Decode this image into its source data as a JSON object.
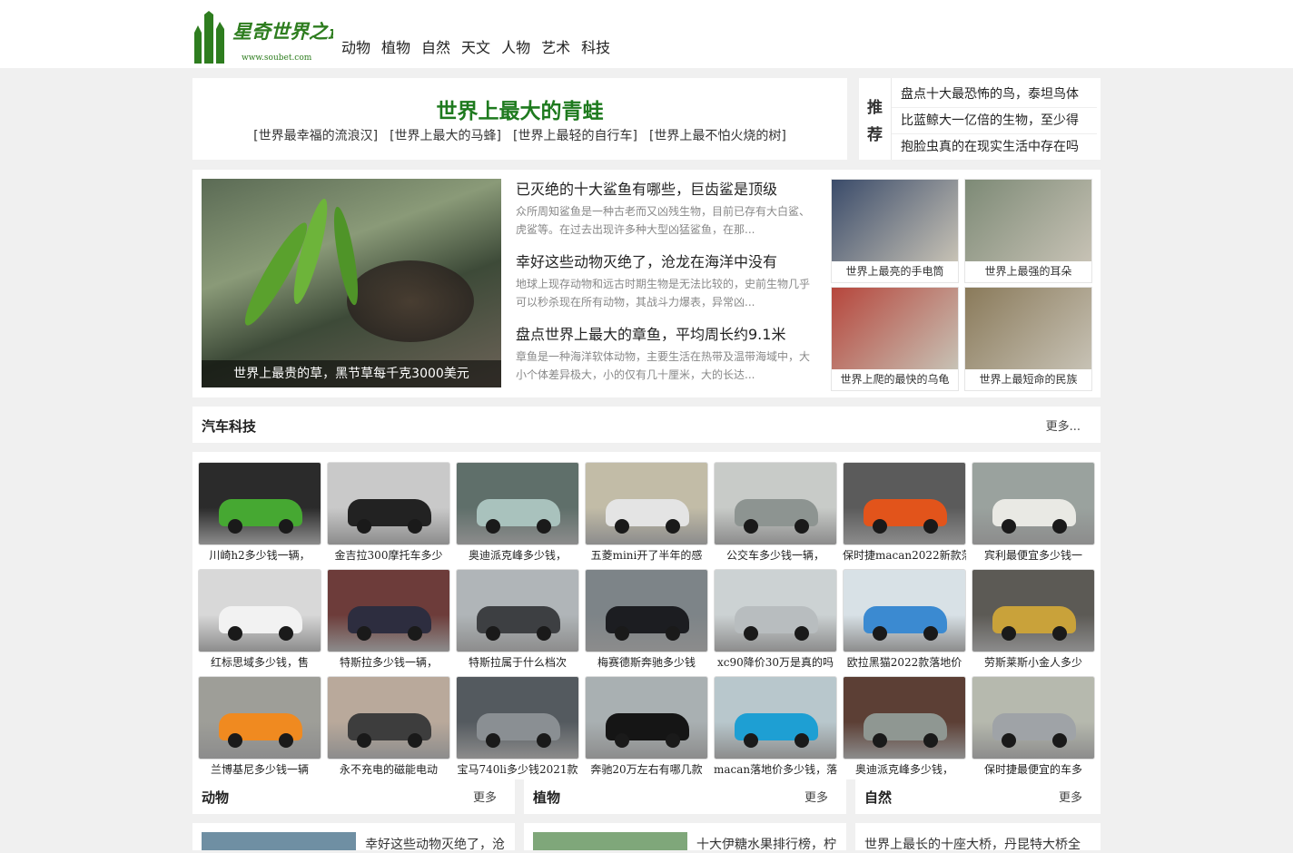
{
  "logo": {
    "text": "星奇世界之最",
    "url_text": "www.soubet.com",
    "color": "#2e7d1f"
  },
  "nav": [
    "动物",
    "植物",
    "自然",
    "天文",
    "人物",
    "艺术",
    "科技"
  ],
  "headline": {
    "title": "世界上最大的青蛙",
    "links": [
      "[世界最幸福的流浪汉]",
      "[世界上最大的马蜂]",
      "[世界上最轻的自行车]",
      "[世界上最不怕火烧的树]"
    ]
  },
  "recommend": {
    "label_1": "推",
    "label_2": "荐",
    "items": [
      "盘点十大最恐怖的鸟，泰坦鸟体",
      "比蓝鲸大一亿倍的生物，至少得",
      "抱脸虫真的在现实生活中存在吗"
    ]
  },
  "feature": {
    "caption": "世界上最贵的草，黑节草每千克3000美元",
    "articles": [
      {
        "title": "已灭绝的十大鲨鱼有哪些，巨齿鲨是顶级",
        "desc": "众所周知鲨鱼是一种古老而又凶残生物，目前已存有大白鲨、虎鲨等。在过去出现许多种大型凶猛鲨鱼，在那..."
      },
      {
        "title": "幸好这些动物灭绝了，沧龙在海洋中没有",
        "desc": "地球上现存动物和远古时期生物是无法比较的，史前生物几乎可以秒杀现在所有动物，其战斗力爆表，异常凶..."
      },
      {
        "title": "盘点世界上最大的章鱼，平均周长约9.1米",
        "desc": "章鱼是一种海洋软体动物，主要生活在热带及温带海域中，大小个体差异极大，小的仅有几十厘米，大的长达..."
      }
    ],
    "thumbs": [
      {
        "caption": "世界上最亮的手电筒",
        "color": "#3a4b6a"
      },
      {
        "caption": "世界上最强的耳朵",
        "color": "#7d8a76"
      },
      {
        "caption": "世界上爬的最快的乌龟",
        "color": "#b6463c"
      },
      {
        "caption": "世界上最短命的民族",
        "color": "#8a7a5a"
      }
    ]
  },
  "car_section": {
    "title": "汽车科技",
    "more": "更多...",
    "items": [
      {
        "caption": "川崎h2多少钱一辆，",
        "color": "#2b2b2b",
        "accent": "#46a832"
      },
      {
        "caption": "金吉拉300摩托车多少",
        "color": "#c9c9c9",
        "accent": "#222222"
      },
      {
        "caption": "奥迪派克峰多少钱，",
        "color": "#5f6f6a",
        "accent": "#a9c2bd"
      },
      {
        "caption": "五菱mini开了半年的感",
        "color": "#c2bca7",
        "accent": "#e4e4e4"
      },
      {
        "caption": "公交车多少钱一辆，",
        "color": "#c8cbc8",
        "accent": "#8d9491"
      },
      {
        "caption": "保时捷macan2022新款落",
        "color": "#5b5b5b",
        "accent": "#e2541b"
      },
      {
        "caption": "宾利最便宜多少钱一",
        "color": "#9aa29e",
        "accent": "#e9e9e4"
      },
      {
        "caption": "红标思域多少钱，售",
        "color": "#d8d8d8",
        "accent": "#f2f2f2"
      },
      {
        "caption": "特斯拉多少钱一辆，",
        "color": "#6d3c3a",
        "accent": "#2d2d3f"
      },
      {
        "caption": "特斯拉属于什么档次",
        "color": "#b0b5b8",
        "accent": "#3d3f42"
      },
      {
        "caption": "梅赛德斯奔驰多少钱",
        "color": "#7d8488",
        "accent": "#1c1d21"
      },
      {
        "caption": "xc90降价30万是真的吗",
        "color": "#ccd2d3",
        "accent": "#b8bdbf"
      },
      {
        "caption": "欧拉黑猫2022款落地价",
        "color": "#d8e1e6",
        "accent": "#3b8ad1"
      },
      {
        "caption": "劳斯莱斯小金人多少",
        "color": "#5c5a55",
        "accent": "#c9a23a"
      },
      {
        "caption": "兰博基尼多少钱一辆",
        "color": "#9e9e98",
        "accent": "#f08a20"
      },
      {
        "caption": "永不充电的磁能电动",
        "color": "#b9a99b",
        "accent": "#3d3d3d"
      },
      {
        "caption": "宝马740li多少钱2021款",
        "color": "#545a5f",
        "accent": "#8a8f93"
      },
      {
        "caption": "奔驰20万左右有哪几款",
        "color": "#a9b0b2",
        "accent": "#151515"
      },
      {
        "caption": "macan落地价多少钱，落",
        "color": "#b8c7cc",
        "accent": "#1e9fd3"
      },
      {
        "caption": "奥迪派克峰多少钱，",
        "color": "#5c3f35",
        "accent": "#8f9792"
      },
      {
        "caption": "保时捷最便宜的车多",
        "color": "#b6b9ae",
        "accent": "#9fa3a7"
      }
    ]
  },
  "categories": [
    {
      "title": "动物",
      "more": "更多",
      "first": "幸好这些动物灭绝了，沧"
    },
    {
      "title": "植物",
      "more": "更多",
      "first": "十大伊糖水果排行榜，柠"
    },
    {
      "title": "自然",
      "more": "更多",
      "first": "世界上最长的十座大桥，丹昆特大桥全"
    }
  ]
}
